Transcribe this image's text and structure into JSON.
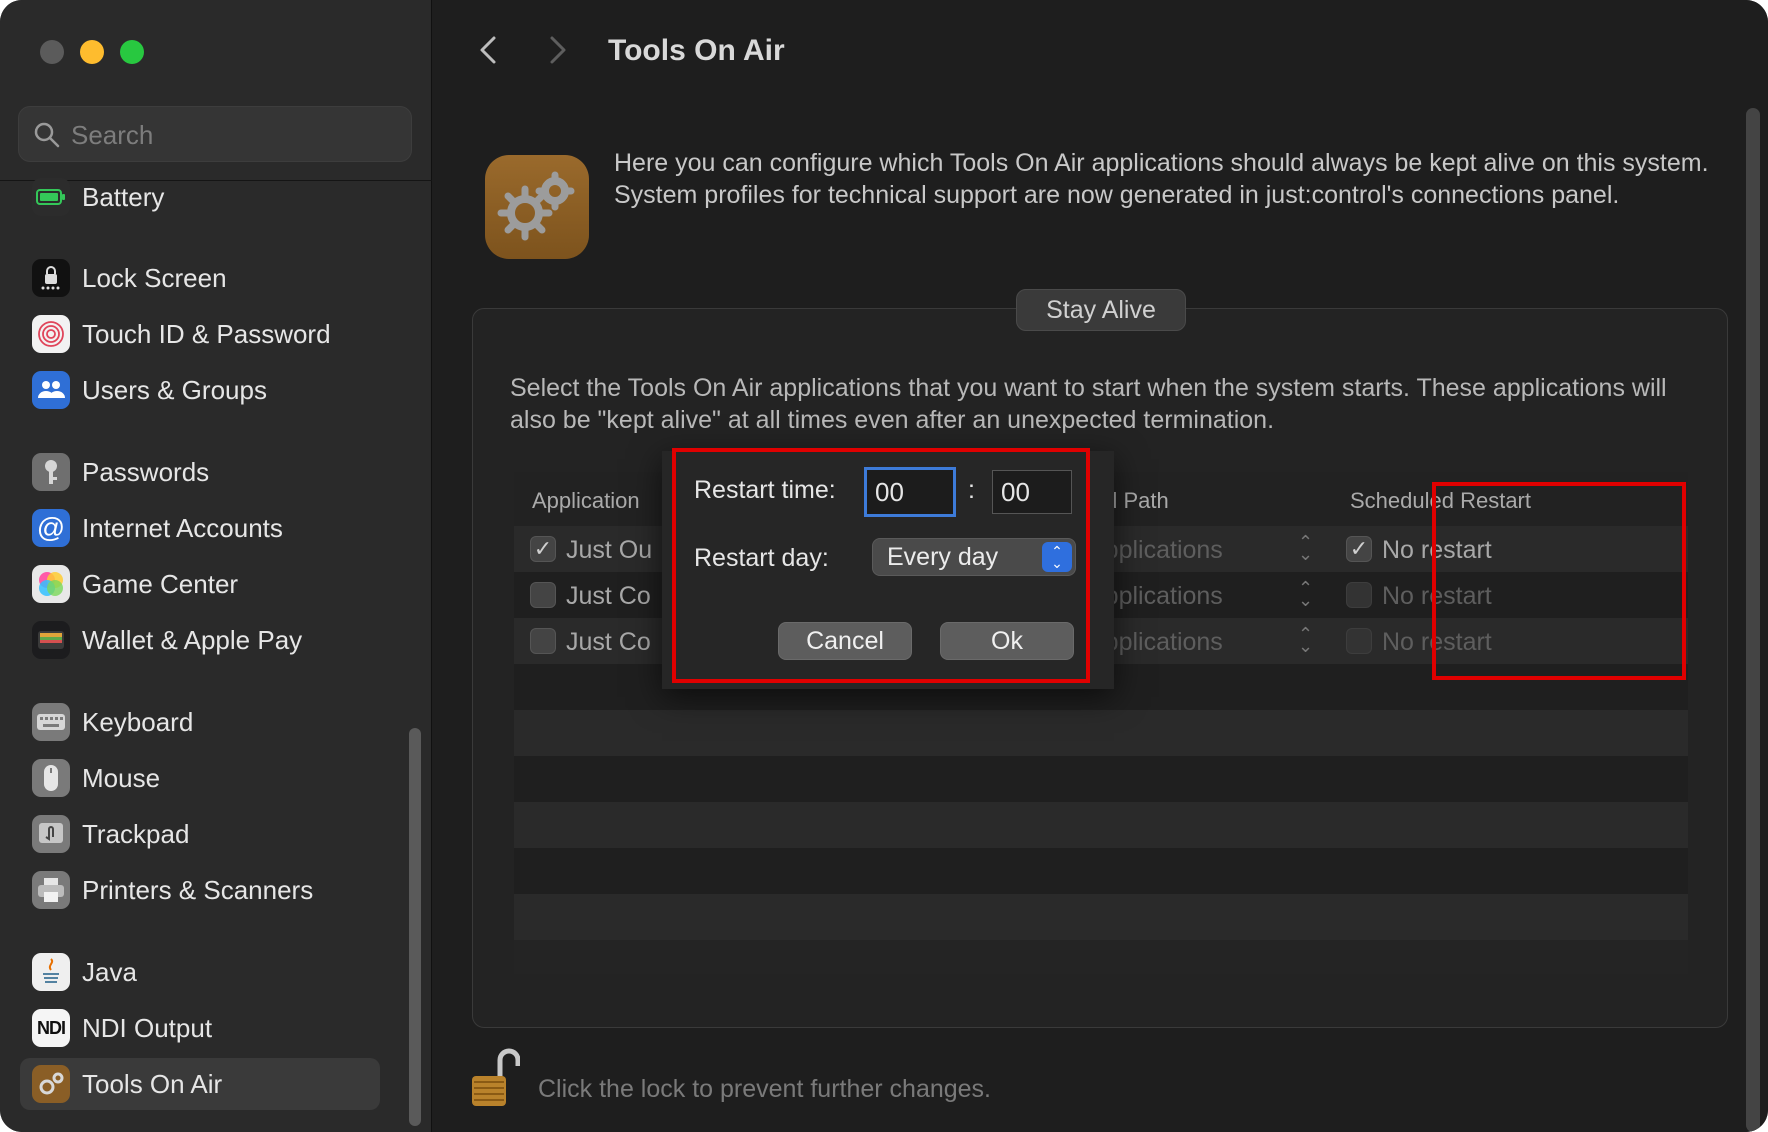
{
  "window": {
    "title": "Tools On Air",
    "traffic_lights": {
      "close": "close",
      "minimize": "minimize",
      "zoom": "zoom"
    }
  },
  "sidebar": {
    "search": {
      "placeholder": "Search",
      "value": ""
    },
    "items": [
      {
        "label": "Battery",
        "icon": "battery-icon",
        "color": "#34c759"
      },
      {
        "label": "Lock Screen",
        "icon": "lock-screen-icon",
        "color": "#1c1c1e"
      },
      {
        "label": "Touch ID & Password",
        "icon": "fingerprint-icon",
        "color": "#f2f2f2"
      },
      {
        "label": "Users & Groups",
        "icon": "users-icon",
        "color": "#2f6fd6"
      },
      {
        "label": "Passwords",
        "icon": "key-icon",
        "color": "#8e8e93"
      },
      {
        "label": "Internet Accounts",
        "icon": "at-icon",
        "color": "#2f6fd6"
      },
      {
        "label": "Game Center",
        "icon": "game-center-icon",
        "color": "#ffffff"
      },
      {
        "label": "Wallet & Apple Pay",
        "icon": "wallet-icon",
        "color": "#1c1c1e"
      },
      {
        "label": "Keyboard",
        "icon": "keyboard-icon",
        "color": "#8e8e93"
      },
      {
        "label": "Mouse",
        "icon": "mouse-icon",
        "color": "#8e8e93"
      },
      {
        "label": "Trackpad",
        "icon": "trackpad-icon",
        "color": "#8e8e93"
      },
      {
        "label": "Printers & Scanners",
        "icon": "printer-icon",
        "color": "#8e8e93"
      },
      {
        "label": "Java",
        "icon": "java-icon",
        "color": "#f2f2f2"
      },
      {
        "label": "NDI Output",
        "icon": "ndi-icon",
        "color": "#ffffff"
      },
      {
        "label": "Tools On Air",
        "icon": "gears-icon",
        "color": "#8a5e26"
      }
    ],
    "ndi_badge": "NDI"
  },
  "main": {
    "title": "Tools On Air",
    "intro": "Here you can configure which Tools On Air applications should always be kept alive on this system. System profiles for technical support are now generated in just:control's connections panel.",
    "group_title": "Stay Alive",
    "group_description": "Select the Tools On Air applications that you want to start when the system starts. These applications will also be \"kept alive\" at all times even after an unexpected termination.",
    "table": {
      "columns": [
        "Application",
        "equired Path",
        "Scheduled Restart"
      ],
      "rows": [
        {
          "checked": true,
          "app": "Just Ou",
          "path": "Applications",
          "restart_checked": true,
          "restart": "No restart"
        },
        {
          "checked": false,
          "app": "Just Co",
          "path": "Applications",
          "restart_checked": false,
          "restart": "No restart"
        },
        {
          "checked": false,
          "app": "Just Co",
          "path": "Applications",
          "restart_checked": false,
          "restart": "No restart"
        }
      ]
    },
    "dialog": {
      "restart_time_label": "Restart time:",
      "hours": "00",
      "separator": ":",
      "minutes": "00",
      "restart_day_label": "Restart day:",
      "restart_day_value": "Every day",
      "cancel_label": "Cancel",
      "ok_label": "Ok"
    },
    "lock_text": "Click the lock to prevent further changes."
  },
  "colors": {
    "accent": "#2f6fde",
    "highlight": "#e00000",
    "background": "#1e1e1e",
    "sidebar": "#2a2a2a"
  }
}
